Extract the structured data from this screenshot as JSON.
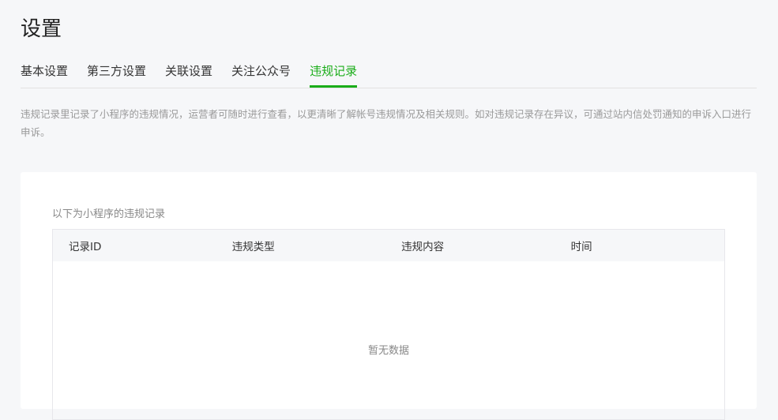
{
  "page": {
    "title": "设置"
  },
  "tabs": [
    {
      "label": "基本设置"
    },
    {
      "label": "第三方设置"
    },
    {
      "label": "关联设置"
    },
    {
      "label": "关注公众号"
    },
    {
      "label": "违规记录",
      "active": true
    }
  ],
  "description": "违规记录里记录了小程序的违规情况，运营者可随时进行查看，以更清晰了解帐号违规情况及相关规则。如对违规记录存在异议，可通过站内信处罚通知的申诉入口进行申诉。",
  "records": {
    "caption": "以下为小程序的违规记录",
    "columns": [
      "记录ID",
      "违规类型",
      "违规内容",
      "时间"
    ],
    "empty_text": "暂无数据"
  },
  "colors": {
    "accent": "#1aad19"
  }
}
